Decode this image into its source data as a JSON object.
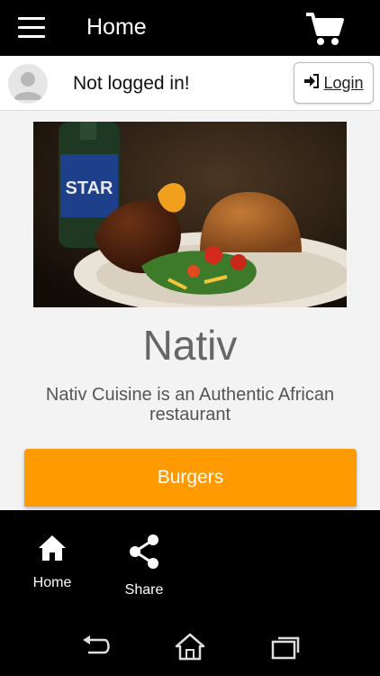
{
  "header": {
    "title": "Home",
    "menu_icon": "hamburger-menu-icon",
    "cart_icon": "shopping-cart-icon"
  },
  "user": {
    "status": "Not logged in!",
    "login_label": "Login",
    "avatar_icon": "user-avatar-icon",
    "login_icon": "sign-in-icon"
  },
  "restaurant": {
    "name": "Nativ",
    "tagline": "Nativ Cuisine is an Authentic African restaurant",
    "bottle_label": "STAR"
  },
  "categories": [
    {
      "label": "Burgers"
    }
  ],
  "bottom_nav": {
    "items": [
      {
        "label": "Home",
        "icon": "home-icon"
      },
      {
        "label": "Share",
        "icon": "share-icon"
      }
    ]
  },
  "system_nav": {
    "back_icon": "back-icon",
    "home_icon": "home-outline-icon",
    "recents_icon": "recent-apps-icon"
  },
  "colors": {
    "bar": "#000000",
    "accent": "#ff9a00",
    "text_gray": "#666666"
  }
}
